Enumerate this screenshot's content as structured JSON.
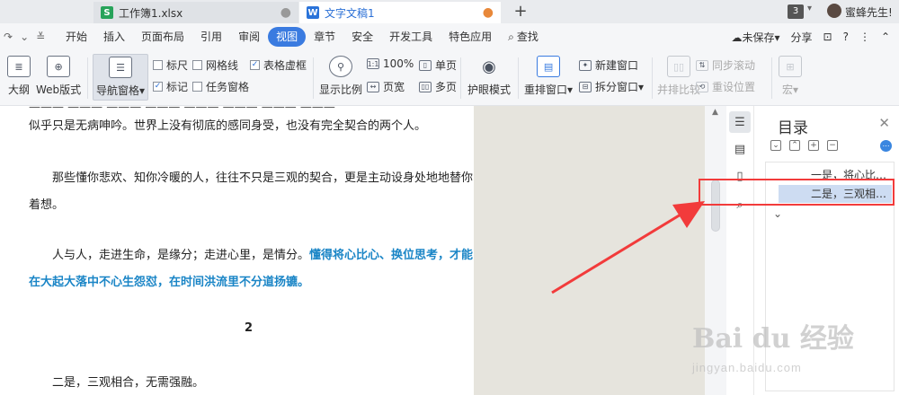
{
  "tabs": [
    {
      "name": "工作簿1.xlsx",
      "icon": "S"
    },
    {
      "name": "文字文稿1",
      "icon": "W"
    }
  ],
  "titlebar": {
    "badge": "3",
    "user": "蜜蜂先生!"
  },
  "menu": {
    "items": [
      "开始",
      "插入",
      "页面布局",
      "引用",
      "审阅",
      "视图",
      "章节",
      "安全",
      "开发工具",
      "特色应用",
      "查找"
    ],
    "active": "视图",
    "right": {
      "save_status": "未保存",
      "share": "分享"
    }
  },
  "ribbon": {
    "outline": "大纲",
    "web_layout": "Web版式",
    "nav_pane": "导航窗格",
    "ruler": "标尺",
    "gridlines": "网格线",
    "table_gridlines": "表格虚框",
    "marks": "标记",
    "task_pane": "任务窗格",
    "zoom": "显示比例",
    "zoom_100": "100%",
    "single_page": "单页",
    "page_width": "页宽",
    "multi_page": "多页",
    "eye_mode": "护眼模式",
    "arrange": "重排窗口",
    "new_window": "新建窗口",
    "split_window": "拆分窗口",
    "side_by_side": "并排比较",
    "sync_scroll": "同步滚动",
    "reset_position": "重设位置",
    "macro": "宏"
  },
  "document": {
    "para1": "似乎只是无病呻吟。世界上没有彻底的感同身受，也没有完全契合的两个人。",
    "para2": "那些懂你悲欢、知你冷暖的人，往往不只是三观的契合，更是主动设身处地地替你着想。",
    "para3_plain": "人与人，走进生命，是缘分；走进心里，是情分。",
    "para3_highlight": "懂得将心比心、换位思考，才能在大起大落中不心生怨怼，在时间洪流里不分道扬镳。",
    "page_number": "2",
    "para4": "二是，三观相合，无需强融。"
  },
  "toc": {
    "title": "目录",
    "items": [
      {
        "label": "一是，将心比…",
        "selected": false
      },
      {
        "label": "二是，三观相…",
        "selected": true
      }
    ]
  },
  "watermark": {
    "brand": "Bai du 经验",
    "url": "jingyan.baidu.com"
  },
  "colors": {
    "accent": "#3a7be0",
    "annotation": "#f23b3b",
    "highlight_text": "#1a85c6"
  }
}
